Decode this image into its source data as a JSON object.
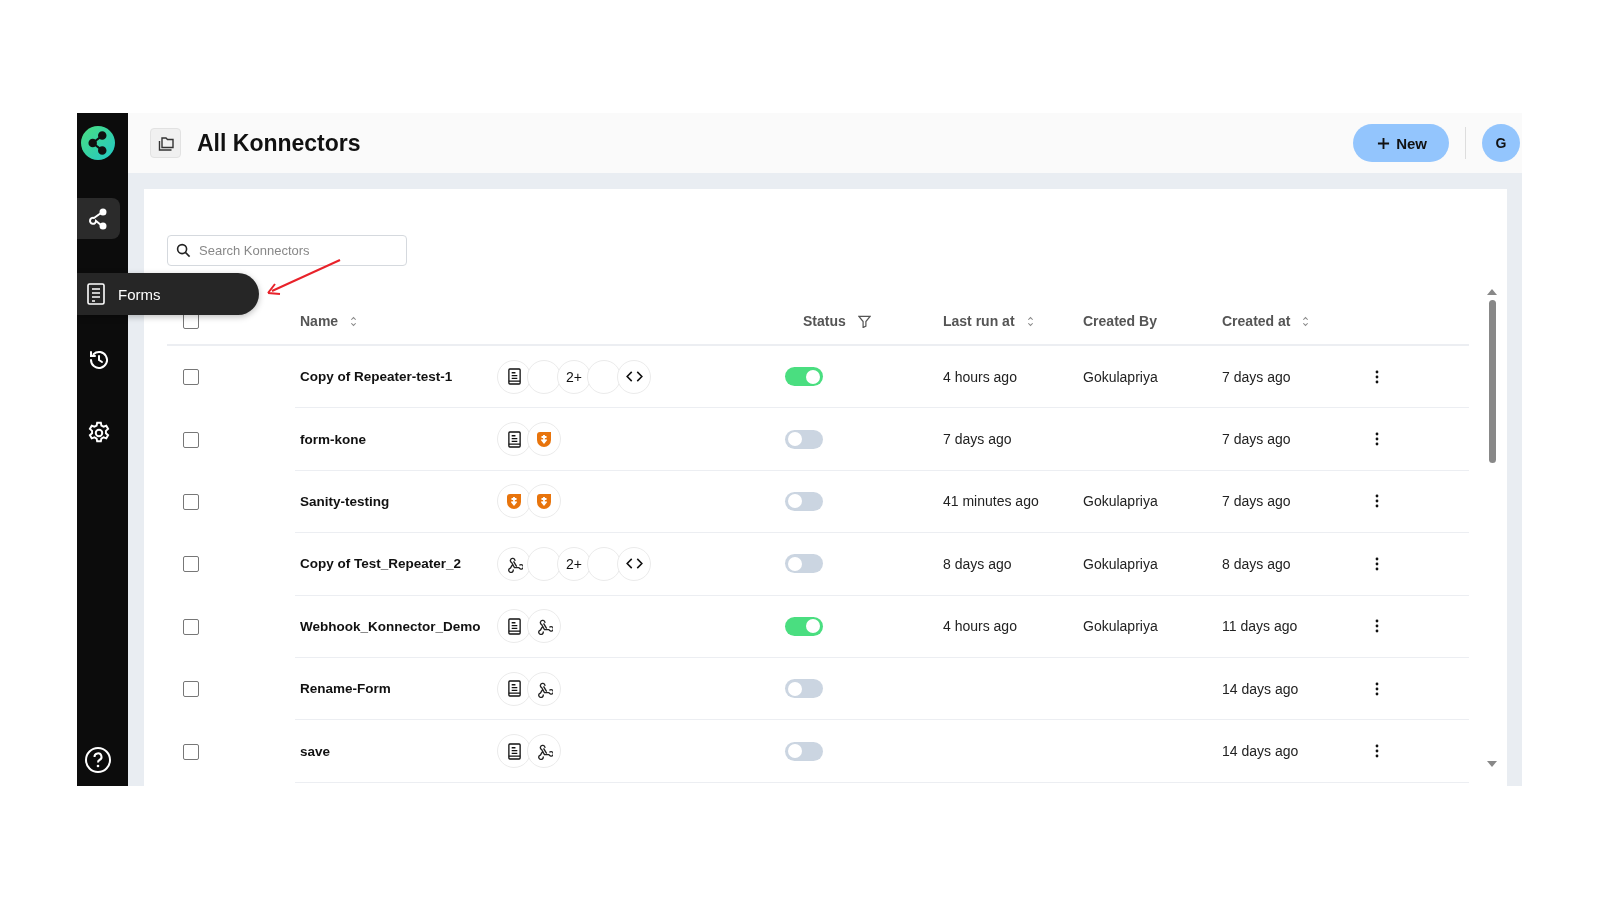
{
  "sidebar": {
    "items": [
      {
        "kind": "konnectors",
        "selected": true
      },
      {
        "kind": "history",
        "selected": false
      },
      {
        "kind": "settings",
        "selected": false
      }
    ]
  },
  "tooltip": {
    "label": "Forms"
  },
  "header": {
    "title": "All Konnectors",
    "new_button": "New",
    "avatar": "G"
  },
  "search": {
    "placeholder": "Search Konnectors"
  },
  "table": {
    "select_all": false,
    "columns": [
      {
        "label": "Name",
        "kind": "sort"
      },
      {
        "label": "Status",
        "kind": "filter"
      },
      {
        "label": "Last run at",
        "kind": "sort"
      },
      {
        "label": "Created By",
        "kind": "plain"
      },
      {
        "label": "Created at",
        "kind": "sort"
      }
    ],
    "rows": [
      {
        "selected": false,
        "name": "Copy of Repeater-test-1",
        "apps": [
          {
            "kind": "form"
          },
          {
            "kind": "blank"
          },
          {
            "kind": "more",
            "text": "2+"
          },
          {
            "kind": "blank"
          },
          {
            "kind": "code"
          }
        ],
        "active": true,
        "last_run": "4 hours ago",
        "created_by": "Gokulapriya",
        "created_at": "7 days ago"
      },
      {
        "selected": false,
        "name": "form-kone",
        "apps": [
          {
            "kind": "form"
          },
          {
            "kind": "plugin"
          }
        ],
        "active": false,
        "last_run": "7 days ago",
        "created_at": "7 days ago"
      },
      {
        "selected": false,
        "name": "Sanity-testing",
        "apps": [
          {
            "kind": "plugin"
          },
          {
            "kind": "plugin"
          }
        ],
        "active": false,
        "last_run": "41 minutes ago",
        "created_by": "Gokulapriya",
        "created_at": "7 days ago"
      },
      {
        "selected": false,
        "name": "Copy of Test_Repeater_2",
        "apps": [
          {
            "kind": "webhook"
          },
          {
            "kind": "blank"
          },
          {
            "kind": "more",
            "text": "2+"
          },
          {
            "kind": "blank"
          },
          {
            "kind": "code"
          }
        ],
        "active": false,
        "last_run": "8 days ago",
        "created_by": "Gokulapriya",
        "created_at": "8 days ago"
      },
      {
        "selected": false,
        "name": "Webhook_Konnector_Demo",
        "apps": [
          {
            "kind": "form"
          },
          {
            "kind": "webhook"
          }
        ],
        "active": true,
        "last_run": "4 hours ago",
        "created_by": "Gokulapriya",
        "created_at": "11 days ago"
      },
      {
        "selected": false,
        "name": "Rename-Form",
        "apps": [
          {
            "kind": "form"
          },
          {
            "kind": "webhook"
          }
        ],
        "active": false,
        "created_at": "14 days ago"
      },
      {
        "selected": false,
        "name": "save",
        "apps": [
          {
            "kind": "form"
          },
          {
            "kind": "webhook"
          }
        ],
        "active": false,
        "created_at": "14 days ago"
      }
    ]
  }
}
